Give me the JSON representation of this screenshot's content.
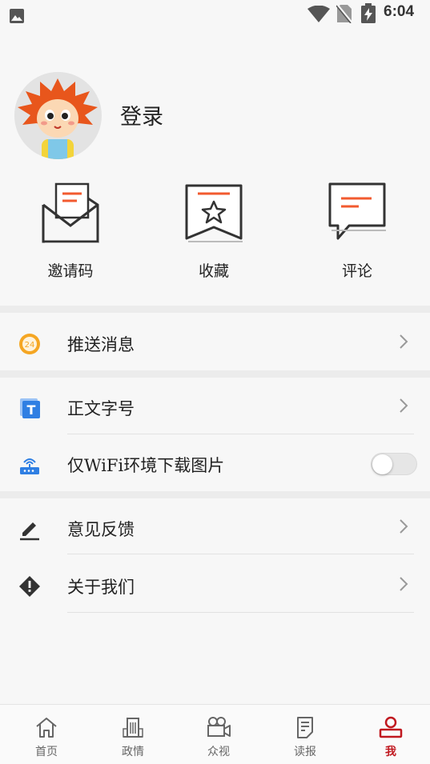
{
  "status_bar": {
    "time": "6:04"
  },
  "profile": {
    "login_label": "登录"
  },
  "quick_actions": [
    {
      "label": "邀请码",
      "icon": "envelope-icon"
    },
    {
      "label": "收藏",
      "icon": "bookmark-star-icon"
    },
    {
      "label": "评论",
      "icon": "comment-icon"
    }
  ],
  "settings": {
    "push": {
      "label": "推送消息",
      "badge": "24"
    },
    "font_size": {
      "label": "正文字号"
    },
    "wifi_images": {
      "label": "仅WiFi环境下载图片",
      "enabled": false
    },
    "feedback": {
      "label": "意见反馈"
    },
    "about": {
      "label": "关于我们"
    }
  },
  "tabs": [
    {
      "label": "首页",
      "icon": "home-icon",
      "active": false
    },
    {
      "label": "政情",
      "icon": "building-icon",
      "active": false
    },
    {
      "label": "众视",
      "icon": "video-camera-icon",
      "active": false
    },
    {
      "label": "读报",
      "icon": "newspaper-icon",
      "active": false
    },
    {
      "label": "我",
      "icon": "person-icon",
      "active": true
    }
  ],
  "colors": {
    "accent": "#c0181f",
    "icon_orange": "#f25a2f",
    "push_badge": "#f5a623",
    "blue_icon": "#2f7fe3"
  }
}
